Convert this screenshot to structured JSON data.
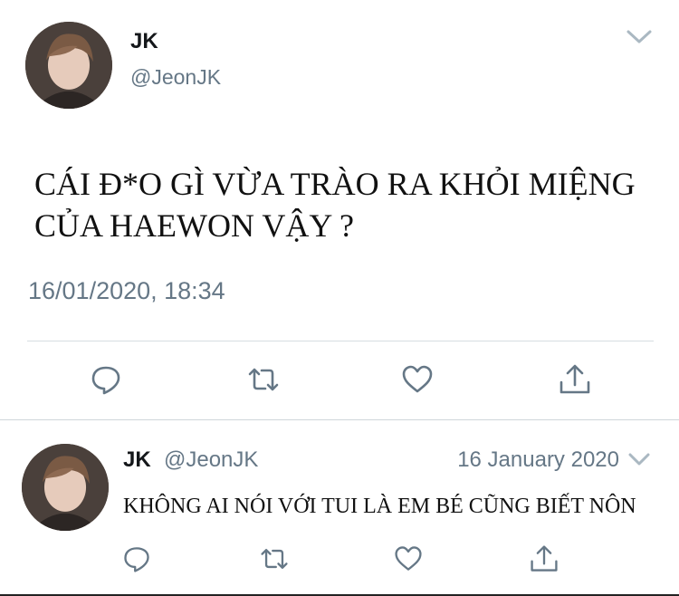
{
  "main_tweet": {
    "display_name": "JK",
    "handle": "@JeonJK",
    "text_line1": "CÁI Đ*O GÌ VỪA TRÀO RA KHỎI MIỆNG",
    "text_line2": "CỦA HAEWON VẬY ?",
    "timestamp": "16/01/2020, 18:34",
    "actions": [
      "reply-icon",
      "retweet-icon",
      "like-icon",
      "share-icon"
    ]
  },
  "reply_tweet": {
    "display_name": "JK",
    "handle": "@JeonJK",
    "date": "16 January 2020",
    "text": "KHÔNG AI NÓI VỚI TUI LÀ EM BÉ CŨNG BIẾT NÔN",
    "actions": [
      "reply-icon",
      "retweet-icon",
      "like-icon",
      "share-icon"
    ]
  },
  "colors": {
    "text_primary": "#14171a",
    "text_secondary": "#657786",
    "icon": "#657786",
    "divider": "#d7dde2"
  }
}
